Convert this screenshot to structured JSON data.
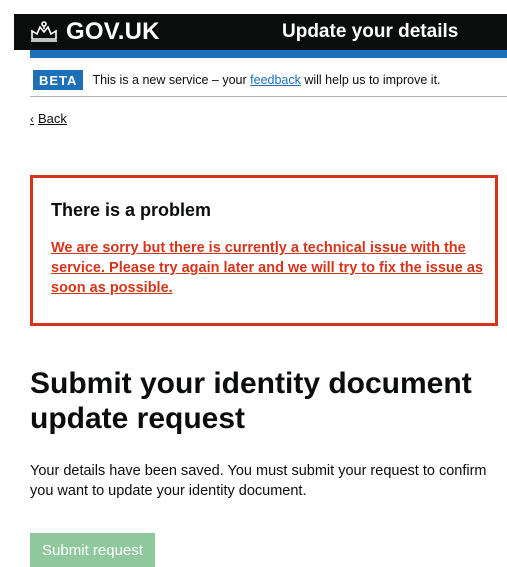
{
  "header": {
    "logo_text": "GOV.UK",
    "service_name": "Update your details"
  },
  "phase_banner": {
    "tag": "BETA",
    "text_before": "This is a new service – your ",
    "link_text": "feedback",
    "text_after": " will help us to improve it."
  },
  "back_link": {
    "label": "Back"
  },
  "error_summary": {
    "title": "There is a problem",
    "message": "We are sorry but there is currently a technical issue with the service. Please try again later and we will try to fix the issue as soon as possible."
  },
  "main": {
    "heading": "Submit your identity document update request",
    "body": "Your details have been saved. You must submit your request to confirm you want to update your identity document.",
    "submit_label": "Submit request"
  },
  "colors": {
    "header_bg": "#0b0c0c",
    "brand_blue": "#1d70b8",
    "error_red": "#d4351c",
    "disabled_button_green": "#8fc89d"
  }
}
